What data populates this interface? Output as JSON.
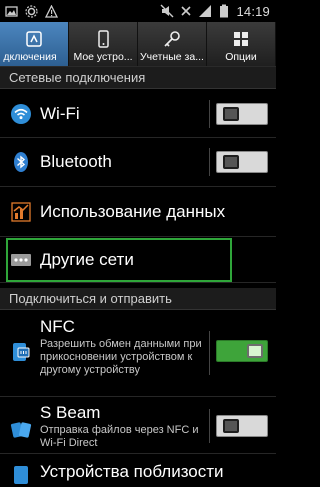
{
  "status_bar": {
    "time": "14:19"
  },
  "tabs": [
    {
      "label": "дключения",
      "active": true
    },
    {
      "label": "Мое устро...",
      "active": false
    },
    {
      "label": "Учетные за...",
      "active": false
    },
    {
      "label": "Опции",
      "active": false
    }
  ],
  "sections": {
    "network": "Сетевые подключения",
    "connect_share": "Подключиться и отправить"
  },
  "rows": {
    "wifi": {
      "label": "Wi-Fi",
      "toggle": "off"
    },
    "bluetooth": {
      "label": "Bluetooth",
      "toggle": "off"
    },
    "data_usage": {
      "label": "Использование данных"
    },
    "other_networks": {
      "label": "Другие сети"
    },
    "nfc": {
      "label": "NFC",
      "description": "Разрешить обмен данными при прикосновении устройством к другому устройству",
      "toggle": "on"
    },
    "sbeam": {
      "label": "S Beam",
      "description": "Отправка файлов через NFC и Wi-Fi Direct",
      "toggle": "off"
    },
    "nearby": {
      "label": "Устройства поблизости"
    }
  },
  "colors": {
    "accent": "#4c86bf",
    "toggle_on": "#3ea43a",
    "highlight": "#2fa63a"
  }
}
